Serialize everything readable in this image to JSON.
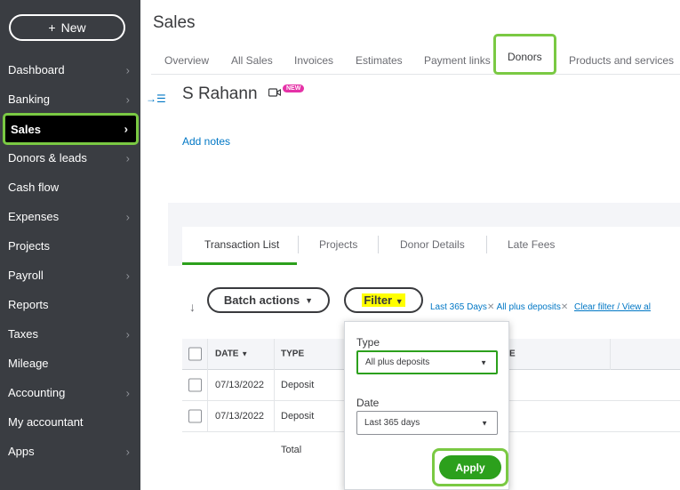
{
  "sidebar": {
    "new_label": "New",
    "items": [
      {
        "label": "Dashboard",
        "chevron": true
      },
      {
        "label": "Banking",
        "chevron": true
      },
      {
        "label": "Sales",
        "chevron": true
      },
      {
        "label": "Donors & leads",
        "chevron": true
      },
      {
        "label": "Cash flow",
        "chevron": false
      },
      {
        "label": "Expenses",
        "chevron": true
      },
      {
        "label": "Projects",
        "chevron": false
      },
      {
        "label": "Payroll",
        "chevron": true
      },
      {
        "label": "Reports",
        "chevron": false
      },
      {
        "label": "Taxes",
        "chevron": true
      },
      {
        "label": "Mileage",
        "chevron": false
      },
      {
        "label": "Accounting",
        "chevron": true
      },
      {
        "label": "My accountant",
        "chevron": false
      },
      {
        "label": "Apps",
        "chevron": true
      }
    ]
  },
  "header": {
    "title": "Sales",
    "tabs": [
      "Overview",
      "All Sales",
      "Invoices",
      "Estimates",
      "Payment links",
      "Donors",
      "Products and services"
    ]
  },
  "donor": {
    "name": "S Rahann",
    "new_badge": "NEW",
    "add_notes": "Add notes"
  },
  "subtabs": [
    "Transaction List",
    "Projects",
    "Donor Details",
    "Late Fees"
  ],
  "toolbar": {
    "batch_label": "Batch actions",
    "filter_label": "Filter",
    "tags": [
      "Last 365 Days",
      "All plus deposits"
    ],
    "clear_label": "Clear filter / View al"
  },
  "table": {
    "headers": {
      "date": "DATE",
      "type": "TYPE",
      "col3": "E"
    },
    "rows": [
      {
        "date": "07/13/2022",
        "type": "Deposit"
      },
      {
        "date": "07/13/2022",
        "type": "Deposit"
      }
    ],
    "total_label": "Total"
  },
  "filter_panel": {
    "type_label": "Type",
    "type_value": "All plus deposits",
    "date_label": "Date",
    "date_value": "Last 365 days",
    "apply_label": "Apply"
  },
  "colors": {
    "accent_green": "#2ca01c",
    "highlight_green": "#7ac943",
    "sidebar_bg": "#3a3d42",
    "link_blue": "#0077c5",
    "badge_pink": "#e532a7"
  }
}
